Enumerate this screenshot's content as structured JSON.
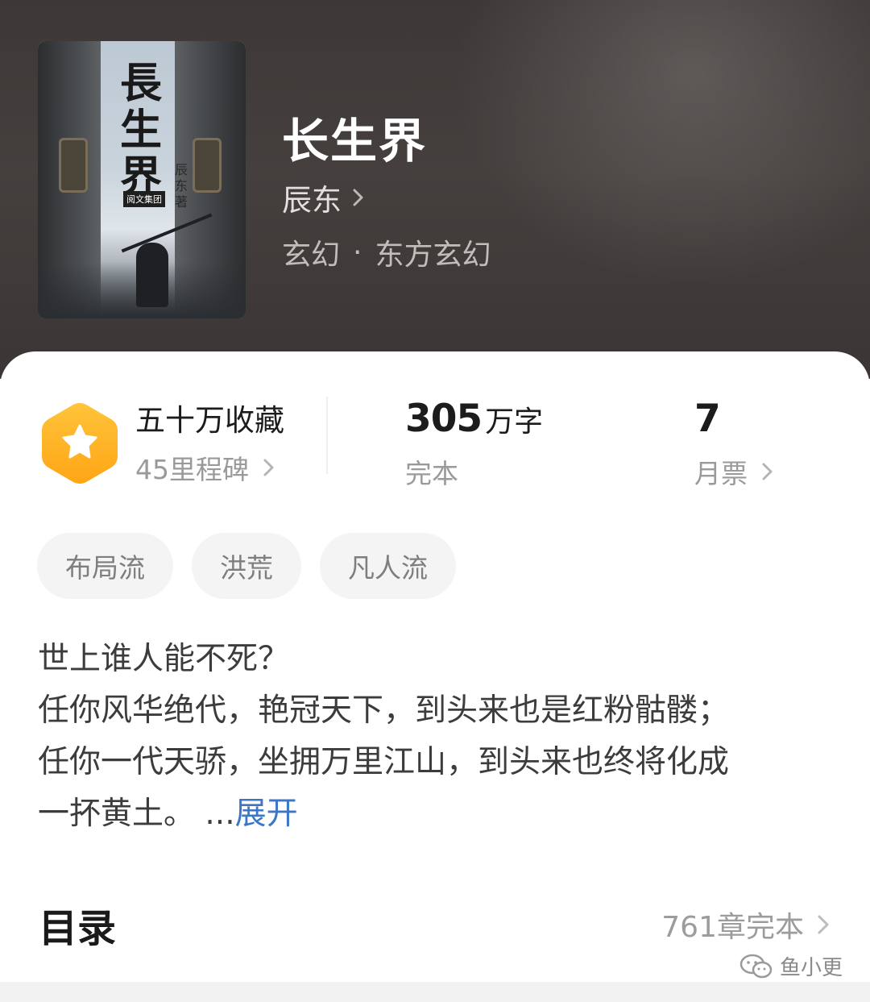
{
  "book": {
    "title": "长生界",
    "author": "辰东",
    "genre": "玄幻",
    "subgenre": "东方玄幻",
    "separator": "·",
    "cover": {
      "title": "長生界",
      "author_line": "辰东著",
      "publisher": "阅文集团"
    }
  },
  "stats": {
    "collection_label": "五十万收藏",
    "milestone_label": "45里程碑",
    "word_count_number": "305",
    "word_count_unit": "万字",
    "status": "完本",
    "monthly_votes_number": "7",
    "monthly_votes_label": "月票"
  },
  "tags": [
    "布局流",
    "洪荒",
    "凡人流"
  ],
  "description": {
    "lines": [
      "世上谁人能不死？",
      "任你风华绝代，艳冠天下，到头来也是红粉骷髅；",
      "任你一代天骄，坐拥万里江山，到头来也终将化成",
      "一抔黄土。 ..."
    ],
    "expand_label": "展开"
  },
  "toc": {
    "title": "目录",
    "chapters": "761章完本"
  },
  "watermark": "鱼小更",
  "colors": {
    "accent_link": "#3d76c6",
    "badge_orange": "#ffb321",
    "header_bg": "#403b3a"
  },
  "icons": [
    "star-badge-icon",
    "chevron-right-icon",
    "wechat-icon"
  ]
}
